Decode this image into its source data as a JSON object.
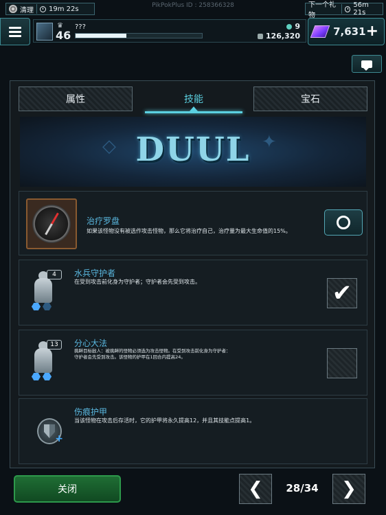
{
  "header": {
    "watermark": "PikPokPlus ID : 258366328",
    "left_timer": {
      "label": "清理",
      "time": "19m 22s"
    },
    "right_timer": {
      "label": "下一个礼物",
      "time": "56m 21s"
    }
  },
  "player": {
    "level": "46",
    "name": "???",
    "xp_progress": 0.4,
    "gems": "9",
    "coins": "126,320",
    "premium_currency": "7,631"
  },
  "tabs": [
    {
      "label": "属性",
      "active": false
    },
    {
      "label": "技能",
      "active": true
    },
    {
      "label": "宝石",
      "active": false
    }
  ],
  "banner": {
    "title": "DUUL"
  },
  "skills": [
    {
      "name": "治疗罗盘",
      "description": "如果该怪物没有被选作攻击怪物，那么它将治疗自己，治疗量为最大生命值的15%。",
      "icon": "compass-icon",
      "control": "cycle-button"
    },
    {
      "name": "水兵守护者",
      "description": "在受到攻击前化身为守护者；守护者会先受到攻击。",
      "icon": "unit-icon",
      "unit_level": "4",
      "control": "checkbox",
      "checked": true
    },
    {
      "name": "分心大法",
      "description_lines": [
        "挑衅目标敌人：被挑衅的怪物必须选为攻击怪物。在受到攻击前化身为守护者：",
        "守护者会先受到攻击。该怪物的护甲在1回合内提高24。"
      ],
      "icon": "unit-icon",
      "unit_level": "13",
      "control": "checkbox",
      "checked": false
    },
    {
      "name": "伤痕护甲",
      "description": "当该怪物在攻击后存活时，它的护甲将永久提高12，并且其技能点提高1。",
      "icon": "shield-plus-icon"
    }
  ],
  "footer": {
    "close_label": "关闭",
    "page_counter": "28/34",
    "prev_symbol": "❮",
    "next_symbol": "❯"
  },
  "colors": {
    "accent": "#5bd0e0",
    "skill_name": "#5ab8e0",
    "close_button": "#1f6e34",
    "premium_crystal": "#a455ff"
  }
}
